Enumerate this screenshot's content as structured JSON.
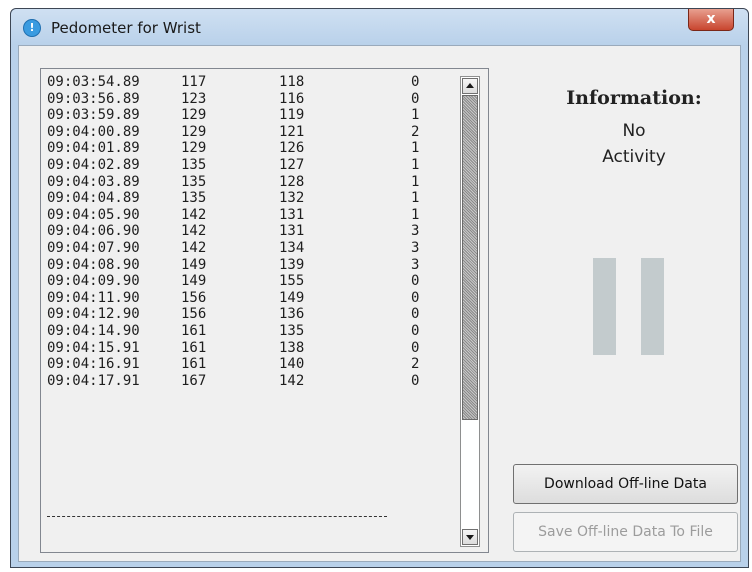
{
  "window": {
    "title": "Pedometer for Wrist",
    "close_label": "x"
  },
  "log_rows": [
    {
      "time": "09:03:54.89",
      "a": "117",
      "b": "118",
      "c": "0"
    },
    {
      "time": "09:03:56.89",
      "a": "123",
      "b": "116",
      "c": "0"
    },
    {
      "time": "09:03:59.89",
      "a": "129",
      "b": "119",
      "c": "1"
    },
    {
      "time": "09:04:00.89",
      "a": "129",
      "b": "121",
      "c": "2"
    },
    {
      "time": "09:04:01.89",
      "a": "129",
      "b": "126",
      "c": "1"
    },
    {
      "time": "09:04:02.89",
      "a": "135",
      "b": "127",
      "c": "1"
    },
    {
      "time": "09:04:03.89",
      "a": "135",
      "b": "128",
      "c": "1"
    },
    {
      "time": "09:04:04.89",
      "a": "135",
      "b": "132",
      "c": "1"
    },
    {
      "time": "09:04:05.90",
      "a": "142",
      "b": "131",
      "c": "1"
    },
    {
      "time": "09:04:06.90",
      "a": "142",
      "b": "131",
      "c": "3"
    },
    {
      "time": "09:04:07.90",
      "a": "142",
      "b": "134",
      "c": "3"
    },
    {
      "time": "09:04:08.90",
      "a": "149",
      "b": "139",
      "c": "3"
    },
    {
      "time": "09:04:09.90",
      "a": "149",
      "b": "155",
      "c": "0"
    },
    {
      "time": "09:04:11.90",
      "a": "156",
      "b": "149",
      "c": "0"
    },
    {
      "time": "09:04:12.90",
      "a": "156",
      "b": "136",
      "c": "0"
    },
    {
      "time": "09:04:14.90",
      "a": "161",
      "b": "135",
      "c": "0"
    },
    {
      "time": "09:04:15.91",
      "a": "161",
      "b": "138",
      "c": "0"
    },
    {
      "time": "09:04:16.91",
      "a": "161",
      "b": "140",
      "c": "2"
    },
    {
      "time": "09:04:17.91",
      "a": "167",
      "b": "142",
      "c": "0"
    }
  ],
  "info": {
    "title": "Information:",
    "status_line1": "No",
    "status_line2": "Activity"
  },
  "buttons": {
    "download": "Download Off-line Data",
    "save": "Save Off-line Data To File"
  },
  "colors": {
    "window_frame": "#b9d1ea",
    "bar": "#c3cbcd",
    "close_button": "#c8452e"
  },
  "icons": {
    "app": "info-circle-icon",
    "scroll_up": "arrow-up-icon",
    "scroll_down": "arrow-down-icon"
  }
}
